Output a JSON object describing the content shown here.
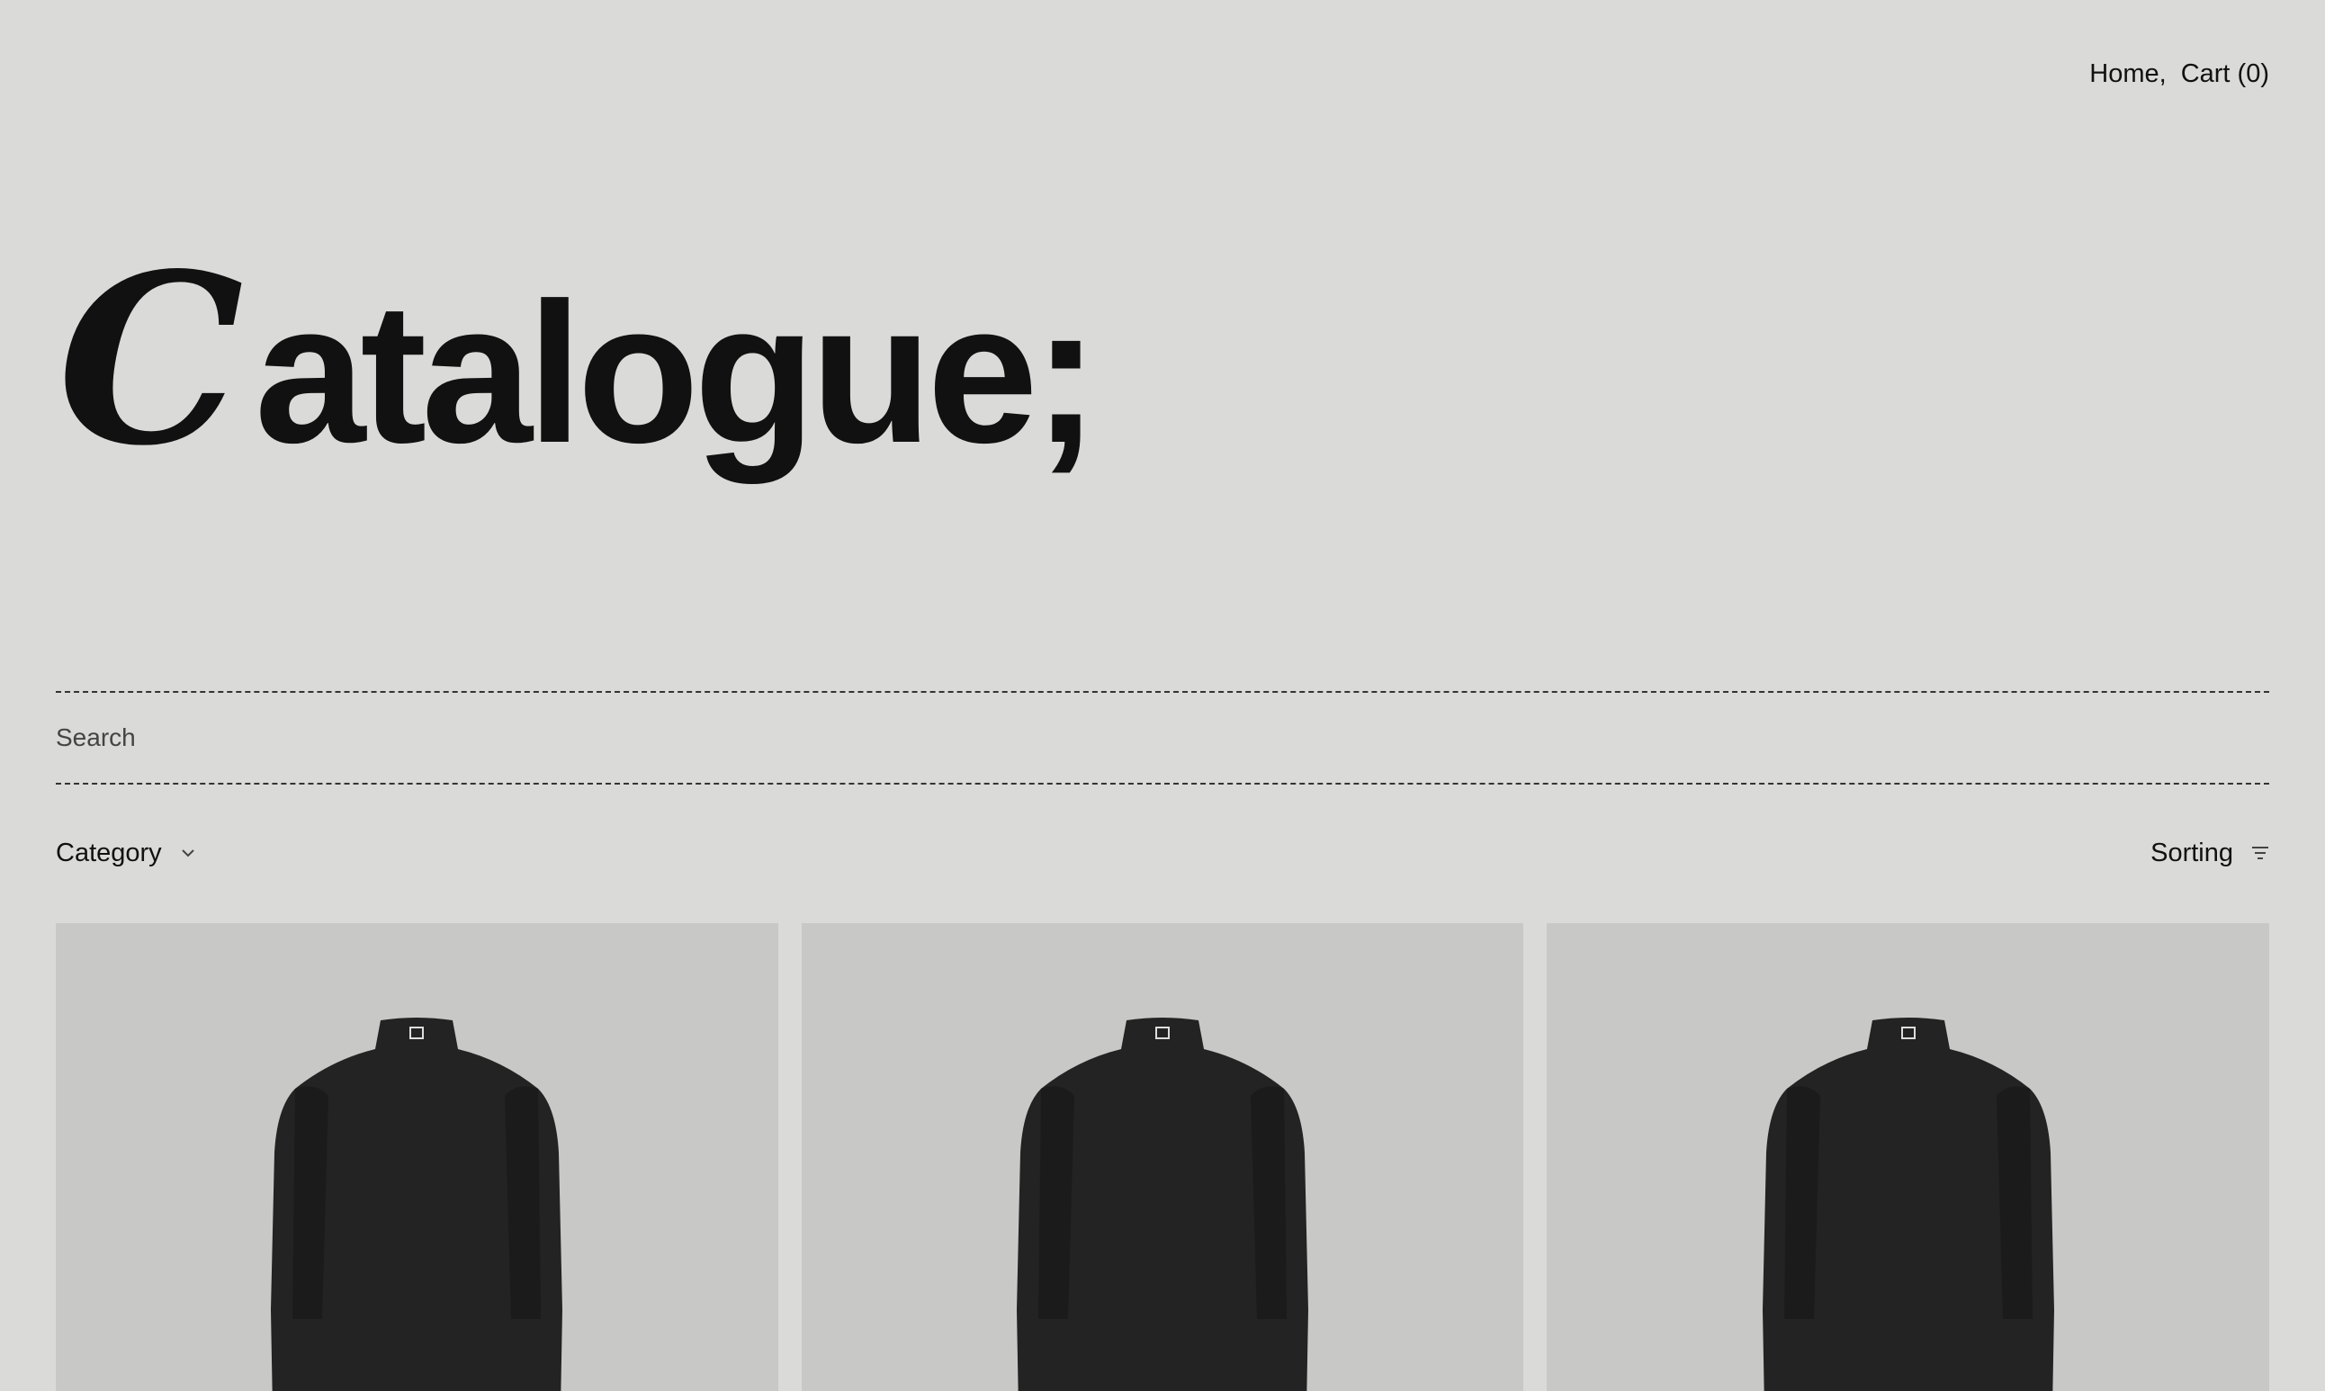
{
  "nav": {
    "home_label": "Home,",
    "cart_label": "Cart (0)"
  },
  "hero": {
    "title_initial": "C",
    "title_rest": "atalogue;"
  },
  "search": {
    "placeholder": "Search"
  },
  "filters": {
    "category_label": "Category",
    "category_icon": "chevron-down-icon",
    "sorting_label": "Sorting",
    "sorting_icon": "sort-icon"
  },
  "products": [
    {
      "image": "black-shirt-back"
    },
    {
      "image": "black-shirt-back"
    },
    {
      "image": "black-shirt-back"
    }
  ],
  "colors": {
    "background": "#dadad8",
    "card_background": "#c8c8c6",
    "text": "#111111",
    "shirt": "#232323"
  }
}
